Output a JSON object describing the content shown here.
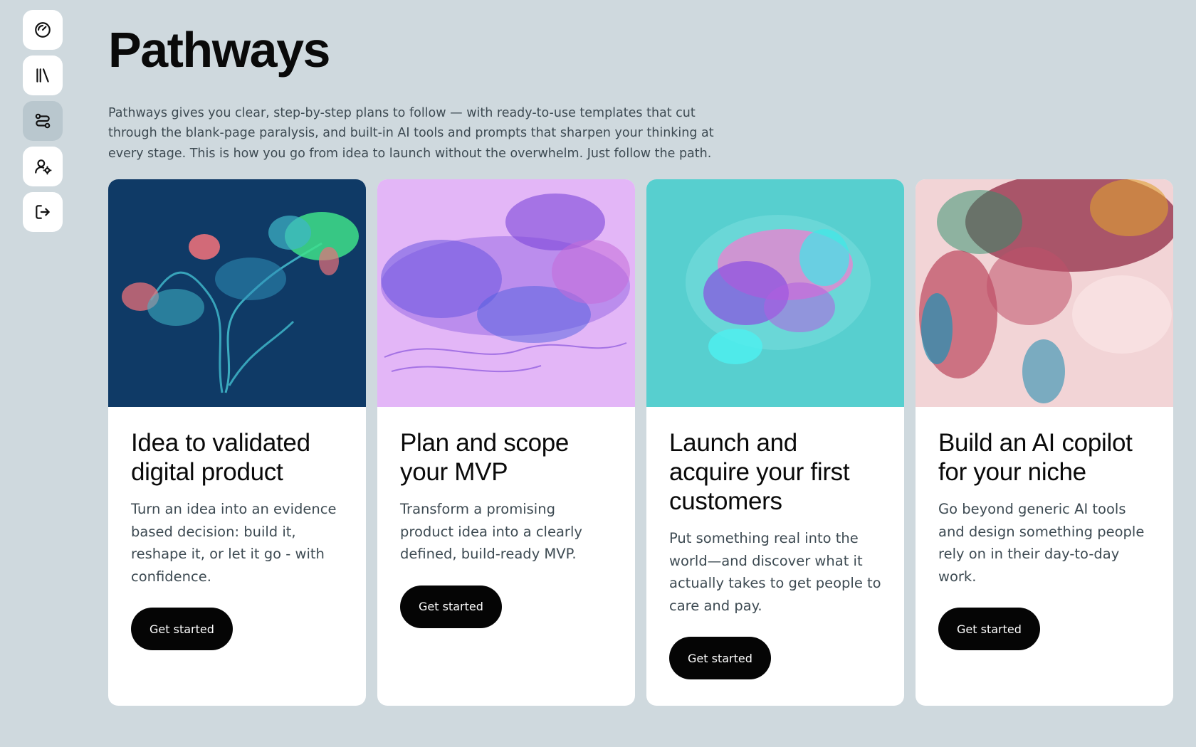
{
  "sidebar": {
    "items": [
      {
        "icon": "gauge-icon",
        "active": false
      },
      {
        "icon": "library-icon",
        "active": false
      },
      {
        "icon": "route-icon",
        "active": true
      },
      {
        "icon": "user-settings-icon",
        "active": false
      },
      {
        "icon": "logout-icon",
        "active": false
      }
    ]
  },
  "header": {
    "title": "Pathways",
    "description": "Pathways gives you clear, step-by-step plans to follow — with ready-to-use templates that cut through the blank-page paralysis, and built-in AI tools and prompts that sharpen your thinking at every stage. This is how you go from idea to launch without the overwhelm. Just follow the path."
  },
  "cards": [
    {
      "title": "Idea to validated digital product",
      "description": "Turn an idea into an evidence based decision: build it, reshape it, or let it go - with confidence.",
      "button": "Get started",
      "image_colors": [
        "#0f3a66",
        "#3fb6c9",
        "#e8707a",
        "#3ee08a"
      ]
    },
    {
      "title": "Plan and scope your MVP",
      "description": "Transform a promising product idea into a clearly defined, build-ready MVP.",
      "button": "Get started",
      "image_colors": [
        "#e3b6f7",
        "#7b46d8",
        "#4f5fe0",
        "#c46bd8"
      ]
    },
    {
      "title": "Launch and acquire your first customers",
      "description": "Put something real into the world—and discover what it actually takes to get people to care and pay.",
      "button": "Get started",
      "image_colors": [
        "#57cfcf",
        "#f07fd0",
        "#8a4fe0",
        "#4ef0f0"
      ]
    },
    {
      "title": "Build an AI copilot for your niche",
      "description": "Go beyond generic AI tools and design something people rely on in their day-to-day work.",
      "button": "Get started",
      "image_colors": [
        "#f2d4d6",
        "#b3304a",
        "#2a8fb0",
        "#e0a030"
      ]
    }
  ]
}
